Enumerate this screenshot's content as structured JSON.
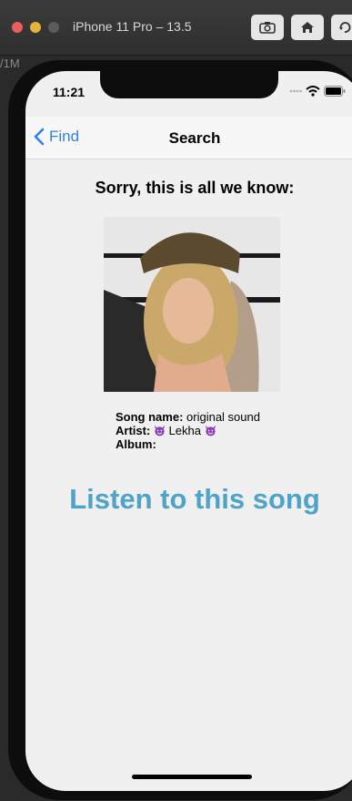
{
  "simulator": {
    "title": "iPhone 11 Pro – 13.5",
    "side_fragment": "/1M",
    "icons": [
      "screenshot-icon",
      "home-icon",
      "rotate-icon"
    ]
  },
  "status_bar": {
    "time": "11:21"
  },
  "nav": {
    "back_label": "Find",
    "title": "Search"
  },
  "content": {
    "heading": "Sorry, this is all we know:",
    "song_label": "Song name:",
    "song_value": "original sound",
    "artist_label": "Artist:",
    "artist_value": "Lekha",
    "album_label": "Album:",
    "album_value": "",
    "listen_label": "Listen to this song"
  },
  "colors": {
    "link_blue": "#2f7ff0",
    "listen_blue": "#4ea3c9",
    "emoji_purple": "#8a3fb8"
  }
}
